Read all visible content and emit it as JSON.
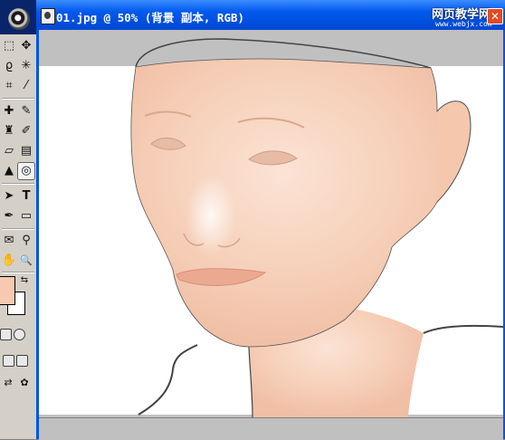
{
  "document": {
    "title": "01.jpg @ 50% (背景 副本, RGB)",
    "filename": "01.jpg",
    "zoom": "50%",
    "layer": "背景 副本",
    "mode": "RGB"
  },
  "watermark": {
    "text": "网页教学网",
    "url": "www.webjx.com"
  },
  "toolbox": {
    "tools": [
      {
        "name": "marquee-tool-icon",
        "glyph": "⬚"
      },
      {
        "name": "move-tool-icon",
        "glyph": "✥"
      },
      {
        "name": "lasso-tool-icon",
        "glyph": "ϱ"
      },
      {
        "name": "magic-wand-tool-icon",
        "glyph": "✳"
      },
      {
        "name": "crop-tool-icon",
        "glyph": "⌗"
      },
      {
        "name": "slice-tool-icon",
        "glyph": "⁄"
      },
      {
        "name": "healing-brush-tool-icon",
        "glyph": "✚"
      },
      {
        "name": "brush-tool-icon",
        "glyph": "✎"
      },
      {
        "name": "clone-stamp-tool-icon",
        "glyph": "♜"
      },
      {
        "name": "history-brush-tool-icon",
        "glyph": "✐"
      },
      {
        "name": "eraser-tool-icon",
        "glyph": "▱"
      },
      {
        "name": "gradient-tool-icon",
        "glyph": "▤"
      },
      {
        "name": "blur-tool-icon",
        "glyph": "▲"
      },
      {
        "name": "dodge-tool-icon",
        "glyph": "◎"
      },
      {
        "name": "path-selection-tool-icon",
        "glyph": "➤"
      },
      {
        "name": "type-tool-icon",
        "glyph": "T"
      },
      {
        "name": "pen-tool-icon",
        "glyph": "✒"
      },
      {
        "name": "rectangle-tool-icon",
        "glyph": "▭"
      },
      {
        "name": "notes-tool-icon",
        "glyph": "✉"
      },
      {
        "name": "eyedropper-tool-icon",
        "glyph": "⚲"
      },
      {
        "name": "hand-tool-icon",
        "glyph": "✋"
      },
      {
        "name": "zoom-tool-icon",
        "glyph": "🔍"
      }
    ],
    "foreground_color": "#f6c9b1",
    "background_color": "#ffffff"
  },
  "colors": {
    "titlebar": "#0054e3",
    "canvas_gray": "#c0c0c0",
    "skin": "#f6c9b1"
  }
}
